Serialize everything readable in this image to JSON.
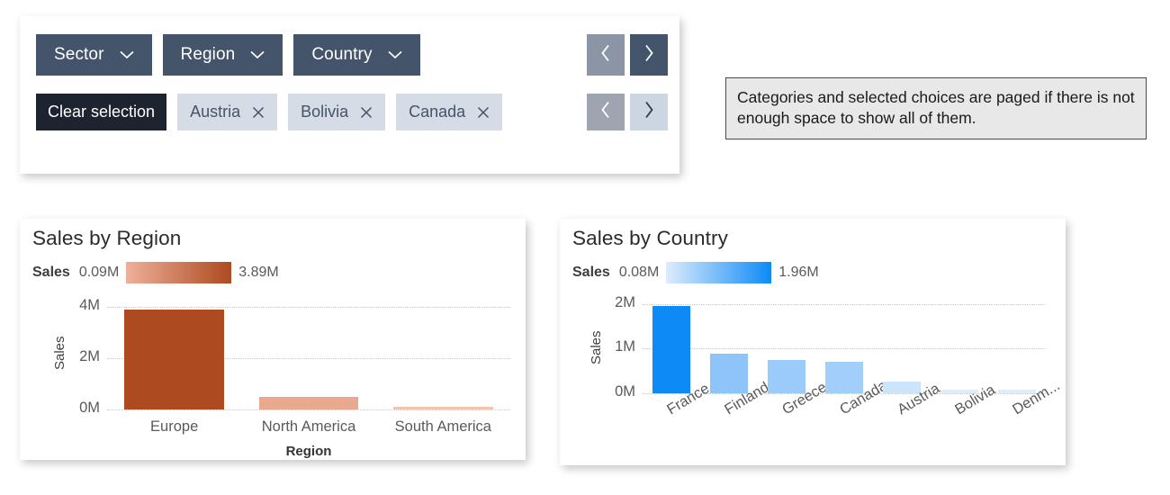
{
  "filter_panel": {
    "categories": [
      {
        "label": "Sector",
        "icon": "chevron-down-icon"
      },
      {
        "label": "Region",
        "icon": "chevron-down-icon"
      },
      {
        "label": "Country",
        "icon": "chevron-down-icon"
      }
    ],
    "clear_label": "Clear selection",
    "chips": [
      {
        "label": "Austria",
        "remove_icon": "close-icon"
      },
      {
        "label": "Bolivia",
        "remove_icon": "close-icon"
      },
      {
        "label": "Canada",
        "remove_icon": "close-icon"
      }
    ],
    "pager_categories": {
      "prev_icon": "chevron-left-icon",
      "next_icon": "chevron-right-icon"
    },
    "pager_selection": {
      "prev_icon": "chevron-left-icon",
      "next_icon": "chevron-right-icon"
    }
  },
  "callout": {
    "text": "Categories and selected choices are paged if there is not enough space to show all of them."
  },
  "colors": {
    "dropdown_bg": "#44546a",
    "clear_bg": "#1d2430",
    "chip_bg": "#d5dce6",
    "chip_text": "#44546a",
    "pager_grey": "#8b95a5",
    "pager_dark": "#44546a",
    "pager_light_grey": "#9ea5b0",
    "pager_pale": "#ccd6e3",
    "callout_bg": "#e8e8e8",
    "callout_border": "#4a4a4a",
    "region_min": "#eeb09a",
    "region_max": "#ad4a20",
    "country_min": "#dcedfd",
    "country_max": "#0d8af5"
  },
  "chart_data": [
    {
      "type": "bar",
      "title": "Sales by Region",
      "xlabel": "Region",
      "ylabel": "Sales",
      "categories": [
        "Europe",
        "North America",
        "South America"
      ],
      "values": [
        3.89,
        0.5,
        0.09
      ],
      "bar_colors": [
        "#ad4a20",
        "#e8a98f",
        "#f2c3ae"
      ],
      "ylim": [
        0,
        4.35
      ],
      "yticks": [
        "0M",
        "2M",
        "4M"
      ],
      "ytick_values": [
        0,
        2,
        4
      ],
      "grid": true,
      "legend": {
        "title": "Sales",
        "min": "0.09M",
        "max": "3.89M",
        "gradient_from": "#eeb09a",
        "gradient_to": "#ad4a20",
        "position": "top-left"
      }
    },
    {
      "type": "bar",
      "title": "Sales by Country",
      "xlabel": "",
      "ylabel": "Sales",
      "categories": [
        "France",
        "Finland",
        "Greece",
        "Canada",
        "Austria",
        "Bolivia",
        "Denm..."
      ],
      "values": [
        1.96,
        0.88,
        0.75,
        0.71,
        0.27,
        0.09,
        0.08
      ],
      "bar_colors": [
        "#0d8af5",
        "#8dc5fb",
        "#9bcbfb",
        "#a2cefc",
        "#cde4fd",
        "#dcedfd",
        "#dcedfd"
      ],
      "ylim": [
        0,
        2.1
      ],
      "yticks": [
        "0M",
        "1M",
        "2M"
      ],
      "ytick_values": [
        0,
        1,
        2
      ],
      "grid": true,
      "legend": {
        "title": "Sales",
        "min": "0.08M",
        "max": "1.96M",
        "gradient_from": "#dcedfd",
        "gradient_to": "#0d8af5",
        "position": "top-left"
      }
    }
  ]
}
